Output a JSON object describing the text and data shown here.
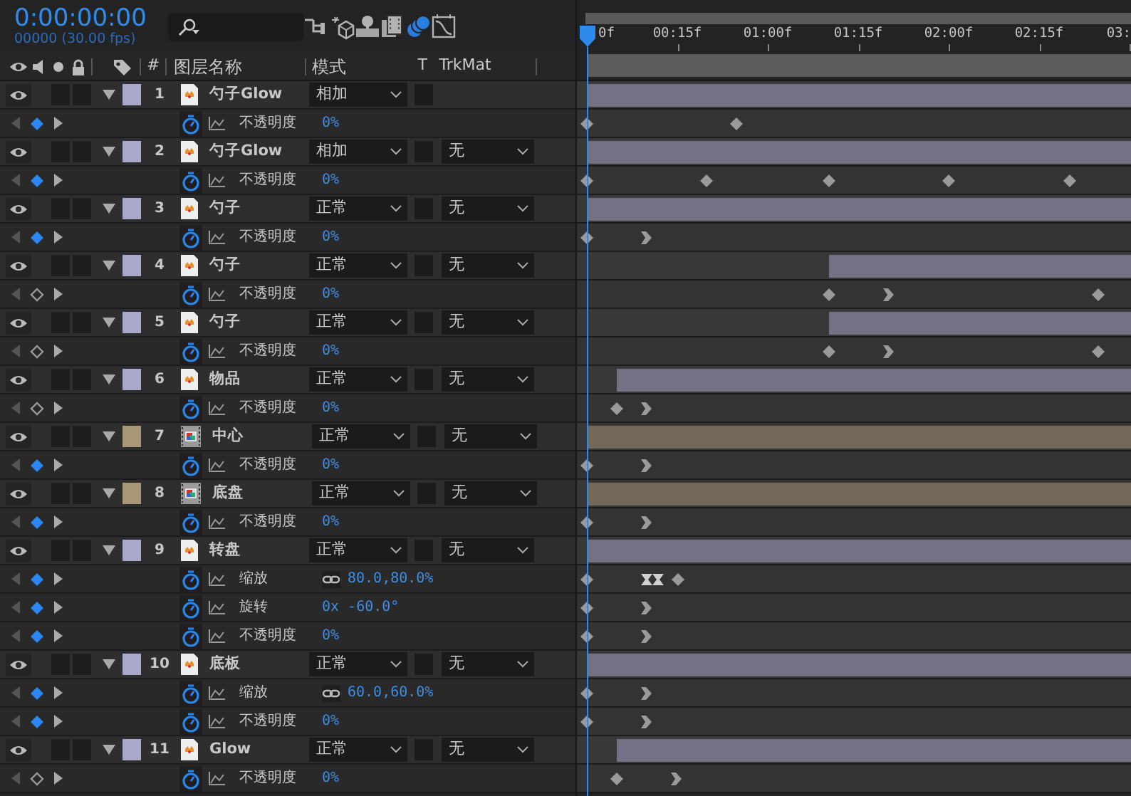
{
  "timecode": "0:00:00:00",
  "frame_info": "00000 (30.00 fps)",
  "toolbar": [
    {
      "kind": "flowchart",
      "on": false
    },
    {
      "kind": "draft3d",
      "on": false
    },
    {
      "kind": "shy",
      "on": false
    },
    {
      "kind": "frame_blend",
      "on": false
    },
    {
      "kind": "motion_blur",
      "on": true
    },
    {
      "kind": "graph",
      "on": false
    }
  ],
  "columns": {
    "number": "#",
    "layer_name": "图层名称",
    "mode": "模式",
    "t": "T",
    "trkmat": "TrkMat"
  },
  "ruler": [
    "0f",
    "00:15f",
    "01:00f",
    "01:15f",
    "02:00f",
    "02:15f",
    "03:"
  ],
  "layers": [
    {
      "number": "1",
      "name": "勺子Glow",
      "kind": "footage",
      "color": "#a8a8c8",
      "visible": true,
      "solo": false,
      "locked": false,
      "preserve_transparency": false,
      "expanded": true,
      "mode": "相加",
      "bar": {
        "level": 1
      },
      "properties": [
        {
          "name": "不透明度",
          "value": "0%",
          "at_keyframe": true,
          "keyframes": [
            {
              "kind": "diamond",
              "level": 0
            },
            {
              "kind": "diamond",
              "level": 0.276
            }
          ]
        }
      ]
    },
    {
      "number": "2",
      "name": "勺子Glow",
      "kind": "footage",
      "color": "#a8a8c8",
      "visible": true,
      "solo": false,
      "locked": false,
      "preserve_transparency": false,
      "expanded": true,
      "mode": "相加",
      "trkmat": "无",
      "bar": {
        "level": 1
      },
      "properties": [
        {
          "name": "不透明度",
          "value": "0%",
          "at_keyframe": true,
          "keyframes": [
            {
              "kind": "diamond",
              "level": 0
            },
            {
              "kind": "diamond",
              "level": 0.221
            },
            {
              "kind": "diamond",
              "level": 0.444
            },
            {
              "kind": "diamond",
              "level": 0.664
            },
            {
              "kind": "diamond",
              "level": 0.887
            }
          ]
        }
      ]
    },
    {
      "number": "3",
      "name": "勺子",
      "kind": "footage",
      "color": "#a8a8c8",
      "visible": true,
      "solo": false,
      "locked": false,
      "preserve_transparency": false,
      "expanded": true,
      "mode": "正常",
      "trkmat": "无",
      "bar": {
        "level": 1
      },
      "properties": [
        {
          "name": "不透明度",
          "value": "0%",
          "at_keyframe": true,
          "keyframes": [
            {
              "kind": "diamond",
              "level": 0
            },
            {
              "kind": "chevron",
              "level": 0.11
            }
          ]
        }
      ]
    },
    {
      "number": "4",
      "name": "勺子",
      "kind": "footage",
      "color": "#a8a8c8",
      "visible": true,
      "solo": false,
      "locked": false,
      "preserve_transparency": false,
      "expanded": true,
      "mode": "正常",
      "trkmat": "无",
      "bar": {
        "level": 0.556
      },
      "properties": [
        {
          "name": "不透明度",
          "value": "0%",
          "at_keyframe": false,
          "keyframes": [
            {
              "kind": "diamond",
              "level": 0.444
            },
            {
              "kind": "chevron",
              "level": 0.554
            },
            {
              "kind": "diamond",
              "level": 0.94
            }
          ]
        }
      ]
    },
    {
      "number": "5",
      "name": "勺子",
      "kind": "footage",
      "color": "#a8a8c8",
      "visible": true,
      "solo": false,
      "locked": false,
      "preserve_transparency": false,
      "expanded": true,
      "mode": "正常",
      "trkmat": "无",
      "bar": {
        "level": 0.556
      },
      "properties": [
        {
          "name": "不透明度",
          "value": "0%",
          "at_keyframe": false,
          "keyframes": [
            {
              "kind": "diamond",
              "level": 0.444
            },
            {
              "kind": "chevron",
              "level": 0.554
            },
            {
              "kind": "diamond",
              "level": 0.94
            }
          ]
        }
      ]
    },
    {
      "number": "6",
      "name": "物品",
      "kind": "footage",
      "color": "#a8a8c8",
      "visible": true,
      "solo": false,
      "locked": false,
      "preserve_transparency": false,
      "expanded": true,
      "mode": "正常",
      "trkmat": "无",
      "bar": {
        "level": 0.945
      },
      "properties": [
        {
          "name": "不透明度",
          "value": "0%",
          "at_keyframe": false,
          "keyframes": [
            {
              "kind": "diamond",
              "level": 0.055
            },
            {
              "kind": "chevron",
              "level": 0.11
            }
          ]
        }
      ]
    },
    {
      "number": "7",
      "name": "中心",
      "kind": "composition",
      "color": "#a89878",
      "visible": true,
      "solo": false,
      "locked": false,
      "preserve_transparency": false,
      "expanded": true,
      "mode": "正常",
      "trkmat": "无",
      "bar": {
        "level": 1
      },
      "properties": [
        {
          "name": "不透明度",
          "value": "0%",
          "at_keyframe": true,
          "keyframes": [
            {
              "kind": "diamond",
              "level": 0
            },
            {
              "kind": "chevron",
              "level": 0.11
            }
          ]
        }
      ]
    },
    {
      "number": "8",
      "name": "底盘",
      "kind": "composition",
      "color": "#a89878",
      "visible": true,
      "solo": false,
      "locked": false,
      "preserve_transparency": false,
      "expanded": true,
      "mode": "正常",
      "trkmat": "无",
      "bar": {
        "level": 1
      },
      "properties": [
        {
          "name": "不透明度",
          "value": "0%",
          "at_keyframe": true,
          "keyframes": [
            {
              "kind": "diamond",
              "level": 0
            },
            {
              "kind": "chevron",
              "level": 0.11
            }
          ]
        }
      ]
    },
    {
      "number": "9",
      "name": "转盘",
      "kind": "footage",
      "color": "#a8a8c8",
      "visible": true,
      "solo": false,
      "locked": false,
      "preserve_transparency": false,
      "expanded": true,
      "mode": "正常",
      "trkmat": "无",
      "bar": {
        "level": 1
      },
      "properties": [
        {
          "name": "缩放",
          "value": "80.0,80.0%",
          "linked": true,
          "at_keyframe": true,
          "keyframes": [
            {
              "kind": "diamond",
              "level": 0
            },
            {
              "kind": "hourglass",
              "level": 0.11
            },
            {
              "kind": "hourglass",
              "level": 0.13
            },
            {
              "kind": "diamond",
              "level": 0.168
            }
          ]
        },
        {
          "name": "旋转",
          "value": "0x -60.0°",
          "at_keyframe": true,
          "keyframes": [
            {
              "kind": "diamond",
              "level": 0
            },
            {
              "kind": "chevron",
              "level": 0.11
            }
          ]
        },
        {
          "name": "不透明度",
          "value": "0%",
          "at_keyframe": true,
          "keyframes": [
            {
              "kind": "diamond",
              "level": 0
            },
            {
              "kind": "chevron",
              "level": 0.11
            }
          ]
        }
      ]
    },
    {
      "number": "10",
      "name": "底板",
      "kind": "footage",
      "color": "#a8a8c8",
      "visible": true,
      "solo": false,
      "locked": false,
      "preserve_transparency": false,
      "expanded": true,
      "mode": "正常",
      "trkmat": "无",
      "bar": {
        "level": 1
      },
      "properties": [
        {
          "name": "缩放",
          "value": "60.0,60.0%",
          "linked": true,
          "at_keyframe": true,
          "keyframes": [
            {
              "kind": "diamond",
              "level": 0
            },
            {
              "kind": "chevron",
              "level": 0.11
            }
          ]
        },
        {
          "name": "不透明度",
          "value": "0%",
          "at_keyframe": true,
          "keyframes": [
            {
              "kind": "diamond",
              "level": 0
            },
            {
              "kind": "chevron",
              "level": 0.11
            }
          ]
        }
      ]
    },
    {
      "number": "11",
      "name": "Glow",
      "kind": "footage",
      "color": "#a8a8c8",
      "visible": true,
      "solo": false,
      "locked": false,
      "preserve_transparency": false,
      "expanded": true,
      "mode": "正常",
      "trkmat": "无",
      "bar": {
        "level": 0.945
      },
      "properties": [
        {
          "name": "不透明度",
          "value": "0%",
          "at_keyframe": false,
          "keyframes": [
            {
              "kind": "diamond",
              "level": 0.055
            },
            {
              "kind": "chevron",
              "level": 0.165
            }
          ]
        }
      ]
    }
  ]
}
